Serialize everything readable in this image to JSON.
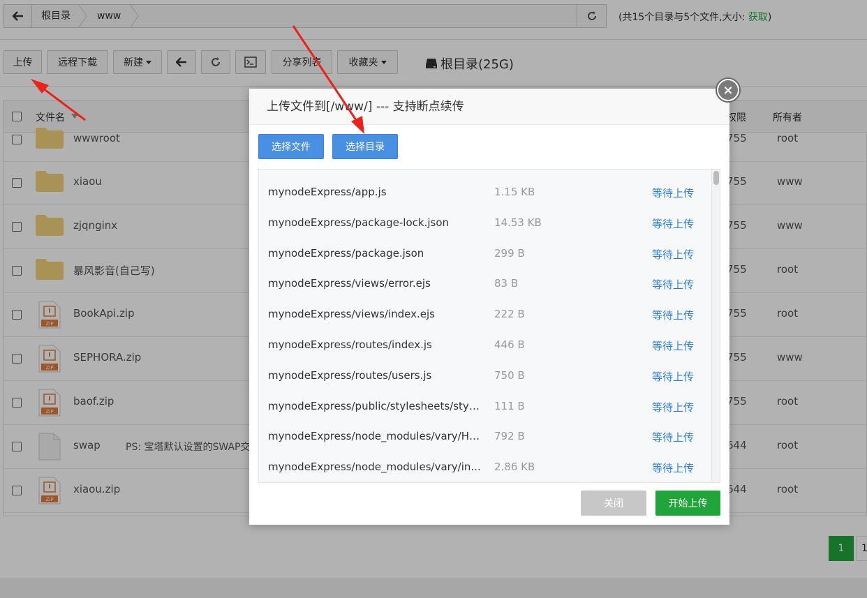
{
  "pathbar": {
    "crumbs": [
      "根目录",
      "www"
    ],
    "info_prefix": "(共15个目录与5个文件,大小: ",
    "info_link": "获取",
    "info_suffix": ")"
  },
  "toolbar": {
    "upload": "上传",
    "remote_download": "远程下载",
    "new": "新建",
    "share_list": "分享列表",
    "favorites": "收藏夹",
    "disk_label": "根目录(25G)"
  },
  "table": {
    "headers": {
      "name": "文件名",
      "perm": "权限",
      "owner": "所有者"
    },
    "rows": [
      {
        "name": "wwwroot",
        "type": "folder",
        "perm": "755",
        "owner": "root",
        "note": ""
      },
      {
        "name": "xiaou",
        "type": "folder",
        "perm": "755",
        "owner": "www",
        "note": ""
      },
      {
        "name": "zjqnginx",
        "type": "folder",
        "perm": "755",
        "owner": "www",
        "note": ""
      },
      {
        "name": "暴风影音(自己写)",
        "type": "folder",
        "perm": "755",
        "owner": "root",
        "note": ""
      },
      {
        "name": "BookApi.zip",
        "type": "zip",
        "perm": "755",
        "owner": "root",
        "note": ""
      },
      {
        "name": "SEPHORA.zip",
        "type": "zip",
        "perm": "755",
        "owner": "www",
        "note": ""
      },
      {
        "name": "baof.zip",
        "type": "zip",
        "perm": "755",
        "owner": "root",
        "note": ""
      },
      {
        "name": "swap",
        "type": "file",
        "perm": "644",
        "owner": "root",
        "note": "PS: 宝塔默认设置的SWAP交"
      },
      {
        "name": "xiaou.zip",
        "type": "zip",
        "perm": "644",
        "owner": "root",
        "note": ""
      }
    ]
  },
  "pager": {
    "current": "1",
    "next": "1"
  },
  "modal": {
    "title": "上传文件到[/www/] --- 支持断点续传",
    "select_files": "选择文件",
    "select_dir": "选择目录",
    "close": "关闭",
    "start": "开始上传",
    "files": [
      {
        "path": "mynodeExpress/app.js",
        "size": "1.15 KB",
        "status": "等待上传"
      },
      {
        "path": "mynodeExpress/package-lock.json",
        "size": "14.53 KB",
        "status": "等待上传"
      },
      {
        "path": "mynodeExpress/package.json",
        "size": "299 B",
        "status": "等待上传"
      },
      {
        "path": "mynodeExpress/views/error.ejs",
        "size": "83 B",
        "status": "等待上传"
      },
      {
        "path": "mynodeExpress/views/index.ejs",
        "size": "222 B",
        "status": "等待上传"
      },
      {
        "path": "mynodeExpress/routes/index.js",
        "size": "446 B",
        "status": "等待上传"
      },
      {
        "path": "mynodeExpress/routes/users.js",
        "size": "750 B",
        "status": "等待上传"
      },
      {
        "path": "mynodeExpress/public/stylesheets/style...",
        "size": "111 B",
        "status": "等待上传"
      },
      {
        "path": "mynodeExpress/node_modules/vary/HI...",
        "size": "792 B",
        "status": "等待上传"
      },
      {
        "path": "mynodeExpress/node_modules/vary/in...",
        "size": "2.86 KB",
        "status": "等待上传"
      }
    ]
  },
  "colors": {
    "green": "#20a53a",
    "blue_btn": "#4a90e2",
    "link_blue": "#2d7fd8",
    "arrow_red": "#e8241c"
  }
}
